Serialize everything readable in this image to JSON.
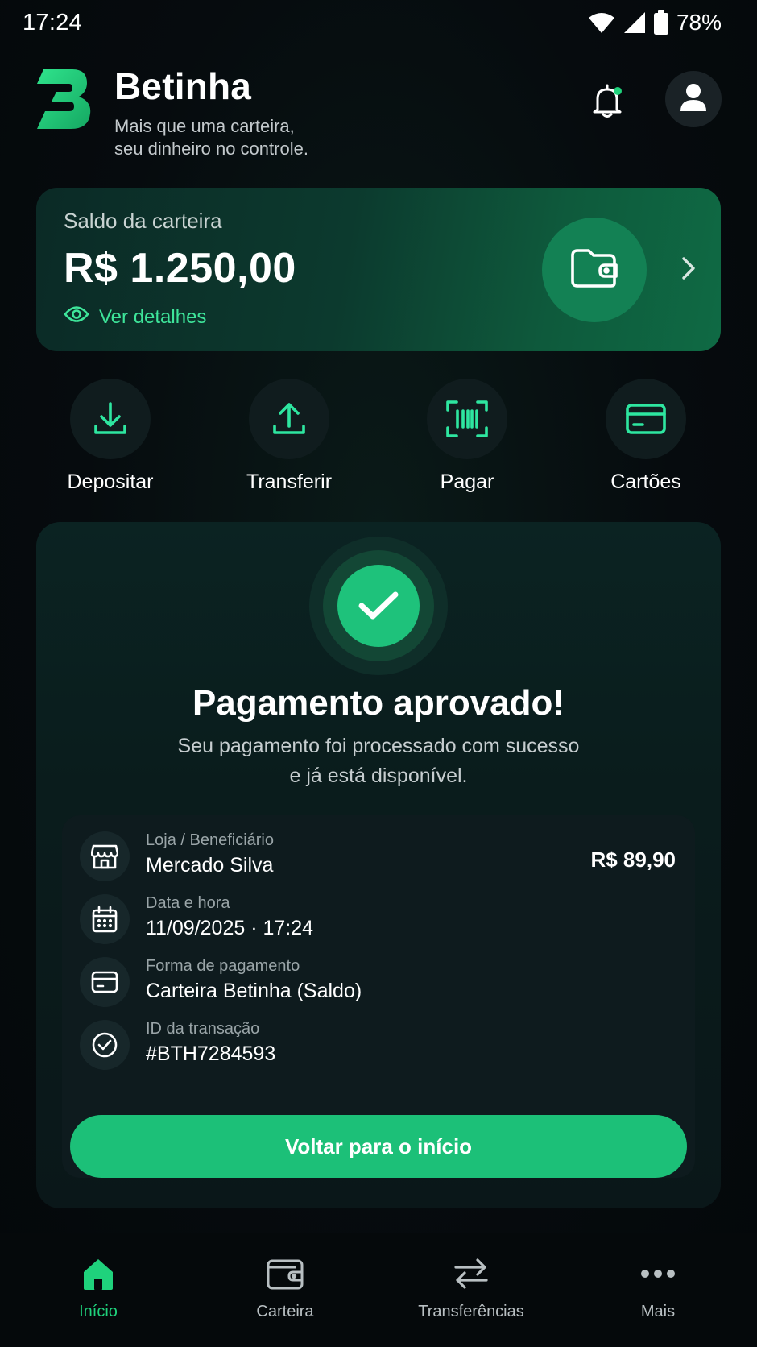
{
  "status_bar": {
    "time": "17:24",
    "battery": "78%",
    "icons": [
      "wifi-icon",
      "signal-icon",
      "battery-icon"
    ]
  },
  "header": {
    "app_name": "Betinha",
    "tagline_line1": "Mais que uma carteira,",
    "tagline_line2": "seu dinheiro no controle.",
    "notification_dot_color": "#1fd27c"
  },
  "balance": {
    "label": "Saldo da carteira",
    "value": "R$ 1.250,00",
    "details_link": "Ver detalhes"
  },
  "actions": [
    {
      "label": "Depositar",
      "icon": "download-icon"
    },
    {
      "label": "Transferir",
      "icon": "upload-icon"
    },
    {
      "label": "Pagar",
      "icon": "barcode-scan-icon"
    },
    {
      "label": "Cartões",
      "icon": "credit-card-icon"
    }
  ],
  "payment": {
    "title": "Pagamento aprovado!",
    "message_line1": "Seu pagamento foi processado com sucesso",
    "message_line2": "e já está disponível.",
    "rows": [
      {
        "label": "Loja / Beneficiário",
        "value": "Mercado Silva",
        "amount": "R$ 89,90",
        "icon": "store-icon"
      },
      {
        "label": "Data e hora",
        "value": "11/09/2025 · 17:24",
        "icon": "calendar-icon"
      },
      {
        "label": "Forma de pagamento",
        "value": "Carteira Betinha (Saldo)",
        "icon": "credit-card-icon"
      },
      {
        "label": "ID da transação",
        "value": "#BTH7284593",
        "icon": "check-circle-icon"
      }
    ],
    "button_label": "Voltar para o início"
  },
  "bottom_nav": [
    {
      "label": "Início",
      "icon": "home-icon",
      "active": true
    },
    {
      "label": "Carteira",
      "icon": "wallet-icon",
      "active": false
    },
    {
      "label": "Transferências",
      "icon": "transfer-arrows-icon",
      "active": false
    },
    {
      "label": "Mais",
      "icon": "more-dots-icon",
      "active": false
    }
  ],
  "colors": {
    "accent": "#1fd27c",
    "button": "#1cc078",
    "background": "#05090c"
  }
}
